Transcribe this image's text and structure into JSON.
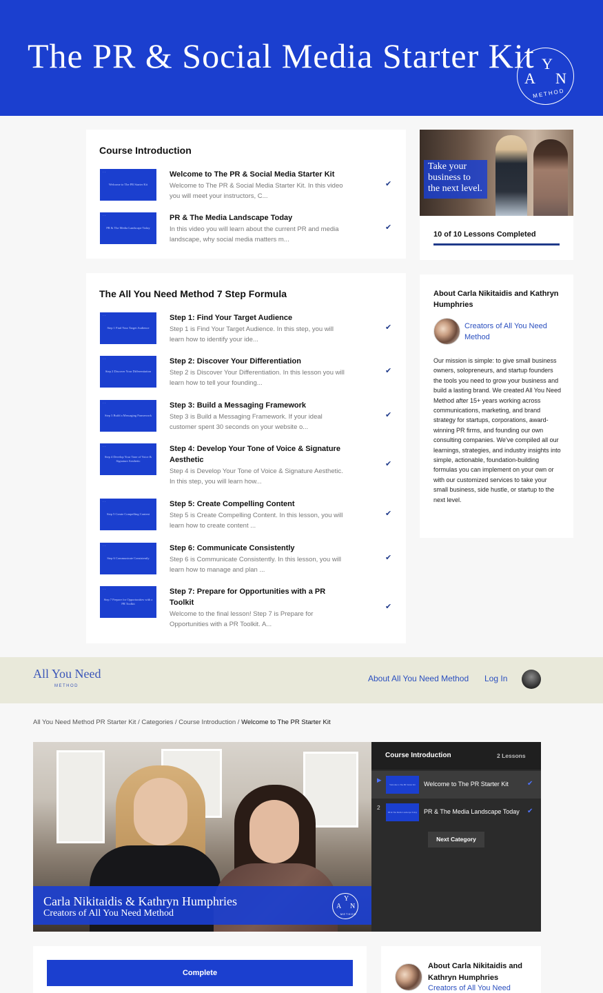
{
  "hero": {
    "title": "The PR & Social Media Starter Kit",
    "logo": {
      "y": "Y",
      "a": "A",
      "n": "N",
      "method": "METHOD"
    }
  },
  "course_intro": {
    "title": "Course Introduction",
    "lessons": [
      {
        "thumb": "Welcome to The PR Starter Kit",
        "title": "Welcome to The PR & Social Media Starter Kit",
        "desc": "Welcome to The PR & Social Media Starter Kit. In this video you will meet your instructors, C...",
        "check": "✔"
      },
      {
        "thumb": "PR & The Media Landscape Today",
        "title": "PR & The Media Landscape Today",
        "desc": "In this video you will learn about the current PR and media landscape, why social media matters m...",
        "check": "✔"
      }
    ]
  },
  "formula": {
    "title": "The All You Need Method 7 Step Formula",
    "lessons": [
      {
        "thumb": "Step 1 Find Your Target Audience",
        "title": "Step 1: Find Your Target Audience",
        "desc": "Step 1 is Find Your Target Audience.  In this step, you will learn how to identify your ide...",
        "check": "✔"
      },
      {
        "thumb": "Step 2 Discover Your Differentiation",
        "title": "Step 2: Discover Your Differentiation",
        "desc": "Step 2 is Discover Your Differentiation. In this lesson you will learn how to tell your founding...",
        "check": "✔"
      },
      {
        "thumb": "Step 3 Build a Messaging Framework",
        "title": "Step 3: Build a Messaging Framework",
        "desc": "Step 3 is Build a Messaging Framework. If your ideal customer spent 30 seconds on your website o...",
        "check": "✔"
      },
      {
        "thumb": "Step 4 Develop Your Tone of Voice & Signature Aesthetic",
        "title": "Step 4: Develop Your Tone of Voice & Signature Aesthetic",
        "desc": "Step 4 is Develop Your Tone of Voice & Signature Aesthetic. In this step, you will learn how...",
        "check": "✔"
      },
      {
        "thumb": "Step 5 Create Compelling Content",
        "title": "Step 5: Create Compelling Content",
        "desc": "Step 5 is Create Compelling Content.  In this lesson, you will learn how to create content ...",
        "check": "✔"
      },
      {
        "thumb": "Step 6 Communicate Consistently",
        "title": "Step 6: Communicate Consistently",
        "desc": "Step 6 is Communicate Consistently.  In this lesson, you will learn how to manage and plan ...",
        "check": "✔"
      },
      {
        "thumb": "Step 7 Prepare for Opportunities with a PR Toolkit",
        "title": "Step 7: Prepare for Opportunities with a PR Toolkit",
        "desc": "Welcome to the final lesson!  Step 7 is Prepare for Opportunities with a PR Toolkit. A...",
        "check": "✔"
      }
    ]
  },
  "sidebar": {
    "photo_overlay": "Take your business to the next level.",
    "progress_label": "10 of 10 Lessons Completed",
    "progress_fraction": 1.0,
    "about_title": "About Carla Nikitaidis and Kathryn Humphries",
    "creators_link": "Creators of All You Need Method",
    "mission": "Our mission is simple: to give small business owners, solopreneurs, and startup founders the tools you need to grow your business and build a lasting brand.  We created All You Need Method after 15+ years working across communications, marketing, and brand strategy for startups, corporations, award-winning PR firms, and founding our own consulting companies. We've compiled all our learnings, strategies, and industry insights into simple, actionable, foundation-building formulas you can implement on your own or with our customized services to take your small business, side hustle, or startup to the next level."
  },
  "nav": {
    "brand": "All You Need",
    "brand_sub": "METHOD",
    "about_link": "About All You Need Method",
    "login_link": "Log In"
  },
  "breadcrumb": {
    "path": "All You Need Method PR Starter Kit / Categories / Course Introduction / ",
    "current": "Welcome to The PR Starter Kit"
  },
  "video": {
    "name": "Carla Nikitaidis & Kathryn Humphries",
    "subtitle": "Creators of All You Need Method"
  },
  "playlist": {
    "title": "Course Introduction",
    "count": "2 Lessons",
    "items": [
      {
        "num": "▶",
        "thumb": "Welcome to The PR Starter Kit",
        "label": "Welcome to The PR Starter Kit",
        "check": "✔"
      },
      {
        "num": "2",
        "thumb": "PR & The Media Landscape Today",
        "label": "PR & The Media Landscape Today",
        "check": "✔"
      }
    ],
    "next": "Next Category"
  },
  "bottom": {
    "complete": "Complete",
    "about_title": "About Carla Nikitaidis and Kathryn Humphries",
    "creators_link": "Creators of All You Need"
  }
}
